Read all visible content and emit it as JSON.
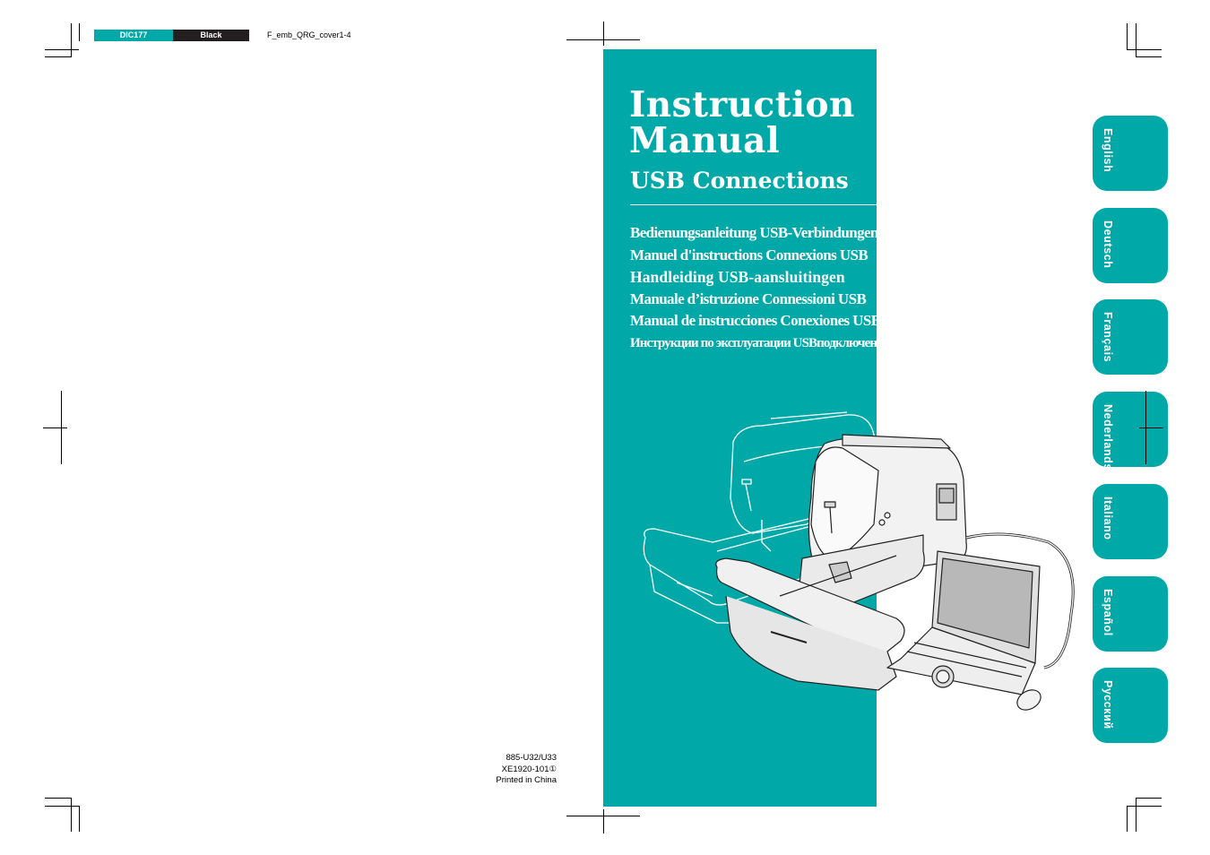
{
  "header": {
    "color_chip_1": "DIC177",
    "color_chip_2": "Black",
    "file_name": "F_emb_QRG_cover1-4"
  },
  "cover": {
    "title_line1": "Instruction",
    "title_line2": "Manual",
    "subtitle": "USB Connections",
    "translations": [
      "Bedienungsanleitung USB-Verbindungen",
      "Manuel d'instructions Connexions USB",
      "Handleiding USB-aansluitingen",
      "Manuale d’istruzione Connessioni USB",
      "Manual de instrucciones Conexiones USB",
      "Инструкции по эксплуатации USBподключение"
    ],
    "illustration": "embroidery-sewing-machine-connected-to-laptop-illustration"
  },
  "back": {
    "model_code": "885-U32/U33",
    "part_code": "XE1920-101①",
    "printed": "Printed in China"
  },
  "language_tabs": [
    {
      "label": "English"
    },
    {
      "label": "Deutsch"
    },
    {
      "label": "Français"
    },
    {
      "label": "Nederlands"
    },
    {
      "label": "Italiano"
    },
    {
      "label": "Español"
    },
    {
      "label": "Русский"
    }
  ],
  "colors": {
    "brand_teal": "#00a8a8",
    "black": "#231f20"
  }
}
